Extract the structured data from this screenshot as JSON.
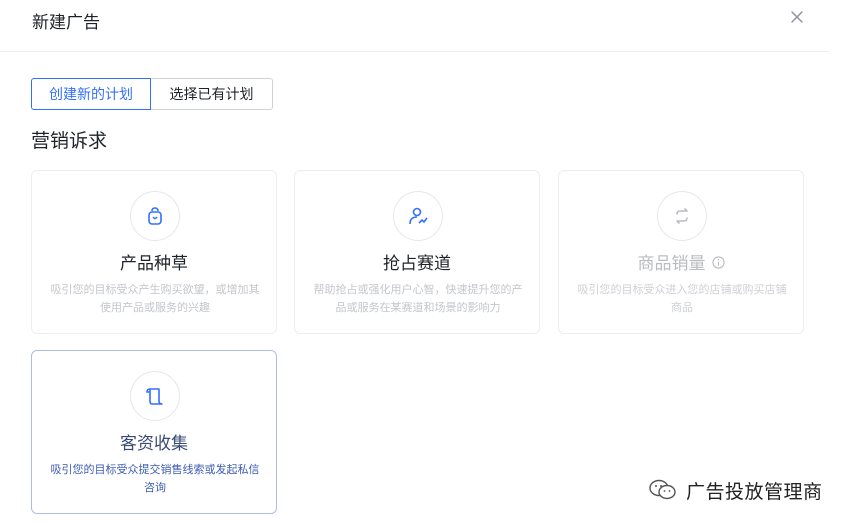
{
  "dialog": {
    "title": "新建广告"
  },
  "tabs": [
    {
      "label": "创建新的计划",
      "active": true
    },
    {
      "label": "选择已有计划",
      "active": false
    }
  ],
  "section": {
    "title": "营销诉求"
  },
  "cards": [
    {
      "title": "产品种草",
      "desc": "吸引您的目标受众产生购买欲望，或增加其使用产品或服务的兴趣",
      "icon": "bag-icon",
      "state": "normal"
    },
    {
      "title": "抢占赛道",
      "desc": "帮助抢占或强化用户心智，快速提升您的产品或服务在某赛道和场景的影响力",
      "icon": "user-growth-icon",
      "state": "normal"
    },
    {
      "title": "商品销量",
      "desc": "吸引您的目标受众进入您的店铺或购买店铺商品",
      "icon": "refresh-icon",
      "state": "disabled"
    },
    {
      "title": "客资收集",
      "desc": "吸引您的目标受众提交销售线索或发起私信咨询",
      "icon": "scroll-icon",
      "state": "selected"
    }
  ],
  "watermark": {
    "text": "广告投放管理商"
  },
  "colors": {
    "accent": "#3370ff",
    "selected_text": "#3d5cb3",
    "muted": "#c3c6cb"
  }
}
